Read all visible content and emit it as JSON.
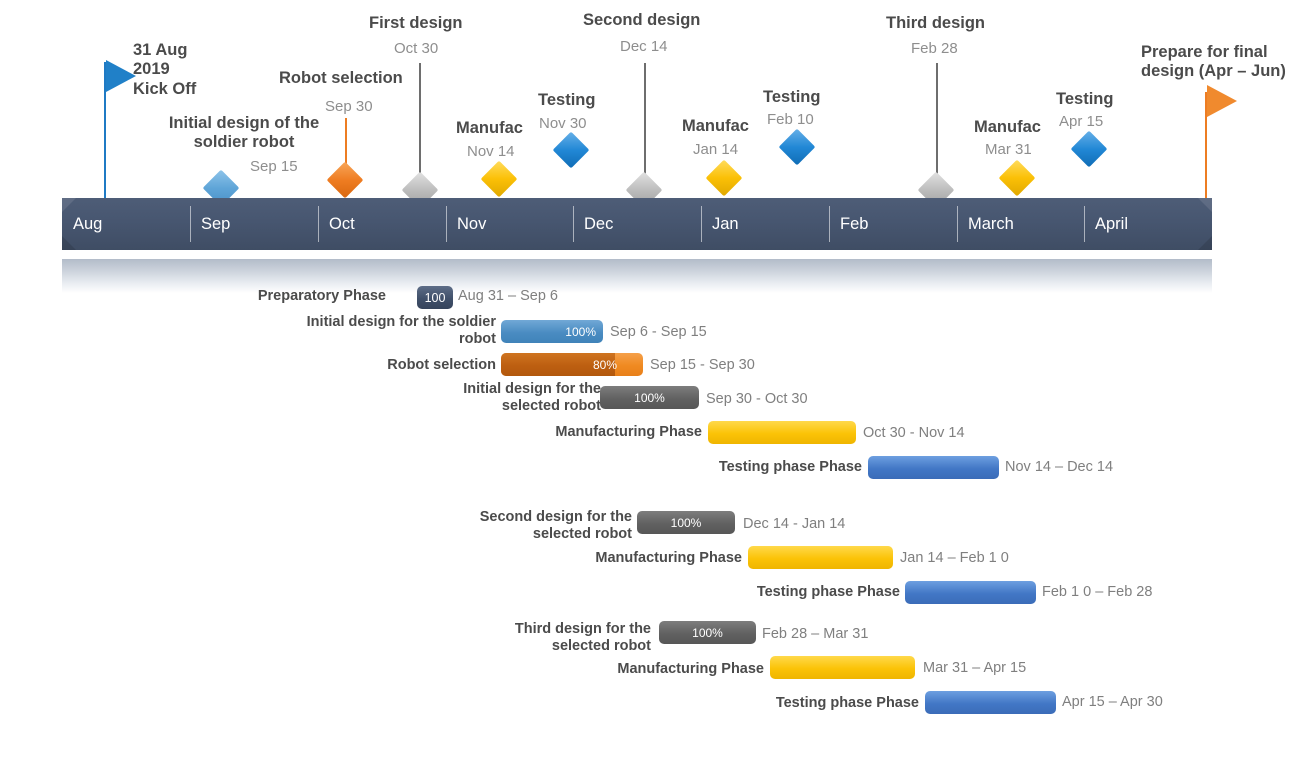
{
  "timeline": {
    "months": [
      "Aug",
      "Sep",
      "Oct",
      "Nov",
      "Dec",
      "Jan",
      "Feb",
      "March",
      "April"
    ],
    "colors": {
      "bar": "#475670",
      "blue_flag": "#1f7ac4",
      "orange_flag": "#ed7d23",
      "gray_marker": "#bdbdbd",
      "yellow_marker": "#fbc006"
    },
    "milestones": [
      {
        "title": "31 Aug\n2019\nKick Off",
        "date": "",
        "marker": "flag-blue"
      },
      {
        "title": "Initial design of the\nsoldier robot",
        "date": "Sep 15",
        "marker": "diamond-lblue"
      },
      {
        "title": "Robot selection",
        "date": "Sep 30",
        "marker": "diamond-orange"
      },
      {
        "title": "First design",
        "date": "Oct 30",
        "marker": "diamond-gray"
      },
      {
        "title": "Manufac",
        "date": "Nov 14",
        "marker": "diamond-yellow"
      },
      {
        "title": "Testing",
        "date": "Nov 30",
        "marker": "diamond-blue"
      },
      {
        "title": "Second design",
        "date": "Dec 14",
        "marker": "diamond-gray"
      },
      {
        "title": "Manufac",
        "date": "Jan 14",
        "marker": "diamond-yellow"
      },
      {
        "title": "Testing",
        "date": "Feb 10",
        "marker": "diamond-blue"
      },
      {
        "title": "Third design",
        "date": "Feb 28",
        "marker": "diamond-gray"
      },
      {
        "title": "Manufac",
        "date": "Mar 31",
        "marker": "diamond-yellow"
      },
      {
        "title": "Testing",
        "date": "Apr 15",
        "marker": "diamond-blue"
      },
      {
        "title": "Prepare for final\ndesign (Apr – Jun)",
        "date": "",
        "marker": "flag-orange"
      }
    ]
  },
  "gantt": {
    "rows": [
      {
        "label": "Preparatory Phase",
        "pct": "100",
        "dates": "Aug 31 – Sep 6",
        "color": "navy"
      },
      {
        "label": "Initial design for the soldier\nrobot",
        "pct": "100%",
        "dates": "Sep 6 - Sep 15",
        "color": "blue"
      },
      {
        "label": "Robot selection",
        "pct": "80%",
        "dates": "Sep 15 - Sep 30",
        "color": "orange-split"
      },
      {
        "label": "Initial design for the\nselected robot",
        "pct": "100%",
        "dates": "Sep 30 - Oct 30",
        "color": "gray"
      },
      {
        "label": "Manufacturing Phase",
        "pct": "",
        "dates": "Oct 30 - Nov 14",
        "color": "yellow"
      },
      {
        "label": "Testing phase Phase",
        "pct": "",
        "dates": "Nov 14 – Dec 14",
        "color": "blue2"
      },
      {
        "label": "Second design for the\nselected robot",
        "pct": "100%",
        "dates": "Dec 14 - Jan 14",
        "color": "gray"
      },
      {
        "label": "Manufacturing Phase",
        "pct": "",
        "dates": "Jan 14 – Feb 1 0",
        "color": "yellow"
      },
      {
        "label": "Testing phase Phase",
        "pct": "",
        "dates": "Feb 1 0 – Feb 28",
        "color": "blue2"
      },
      {
        "label": "Third design for the\nselected robot",
        "pct": "100%",
        "dates": "Feb 28 – Mar 31",
        "color": "gray"
      },
      {
        "label": "Manufacturing Phase",
        "pct": "",
        "dates": "Mar 31 – Apr 15",
        "color": "yellow"
      },
      {
        "label": "Testing phase Phase",
        "pct": "",
        "dates": "Apr 15  – Apr 30",
        "color": "blue2"
      }
    ]
  },
  "chart_data": {
    "type": "table",
    "title": "Robot project Gantt chart timeline",
    "categories": [
      "Aug",
      "Sep",
      "Oct",
      "Nov",
      "Dec",
      "Jan",
      "Feb",
      "March",
      "April"
    ],
    "series": [
      {
        "name": "Preparatory Phase",
        "start": "Aug 31",
        "end": "Sep 6",
        "percent": 100
      },
      {
        "name": "Initial design for the soldier robot",
        "start": "Sep 6",
        "end": "Sep 15",
        "percent": 100
      },
      {
        "name": "Robot selection",
        "start": "Sep 15",
        "end": "Sep 30",
        "percent": 80
      },
      {
        "name": "Initial design for the selected robot",
        "start": "Sep 30",
        "end": "Oct 30",
        "percent": 100
      },
      {
        "name": "Manufacturing Phase",
        "start": "Oct 30",
        "end": "Nov 14",
        "percent": null
      },
      {
        "name": "Testing phase Phase",
        "start": "Nov 14",
        "end": "Dec 14",
        "percent": null
      },
      {
        "name": "Second design for the selected robot",
        "start": "Dec 14",
        "end": "Jan 14",
        "percent": 100
      },
      {
        "name": "Manufacturing Phase",
        "start": "Jan 14",
        "end": "Feb 10",
        "percent": null
      },
      {
        "name": "Testing phase Phase",
        "start": "Feb 10",
        "end": "Feb 28",
        "percent": null
      },
      {
        "name": "Third design for the selected robot",
        "start": "Feb 28",
        "end": "Mar 31",
        "percent": 100
      },
      {
        "name": "Manufacturing Phase",
        "start": "Mar 31",
        "end": "Apr 15",
        "percent": null
      },
      {
        "name": "Testing phase Phase",
        "start": "Apr 15",
        "end": "Apr 30",
        "percent": null
      }
    ],
    "milestones": [
      {
        "label": "31 Aug 2019 Kick Off",
        "date": "Aug 31"
      },
      {
        "label": "Initial design of the soldier robot",
        "date": "Sep 15"
      },
      {
        "label": "Robot selection",
        "date": "Sep 30"
      },
      {
        "label": "First design",
        "date": "Oct 30"
      },
      {
        "label": "Manufac",
        "date": "Nov 14"
      },
      {
        "label": "Testing",
        "date": "Nov 30"
      },
      {
        "label": "Second design",
        "date": "Dec 14"
      },
      {
        "label": "Manufac",
        "date": "Jan 14"
      },
      {
        "label": "Testing",
        "date": "Feb 10"
      },
      {
        "label": "Third design",
        "date": "Feb 28"
      },
      {
        "label": "Manufac",
        "date": "Mar 31"
      },
      {
        "label": "Testing",
        "date": "Apr 15"
      },
      {
        "label": "Prepare for final design (Apr – Jun)",
        "date": "Apr"
      }
    ],
    "xlabel": "",
    "ylabel": "",
    "grid": false,
    "legend": "none"
  }
}
